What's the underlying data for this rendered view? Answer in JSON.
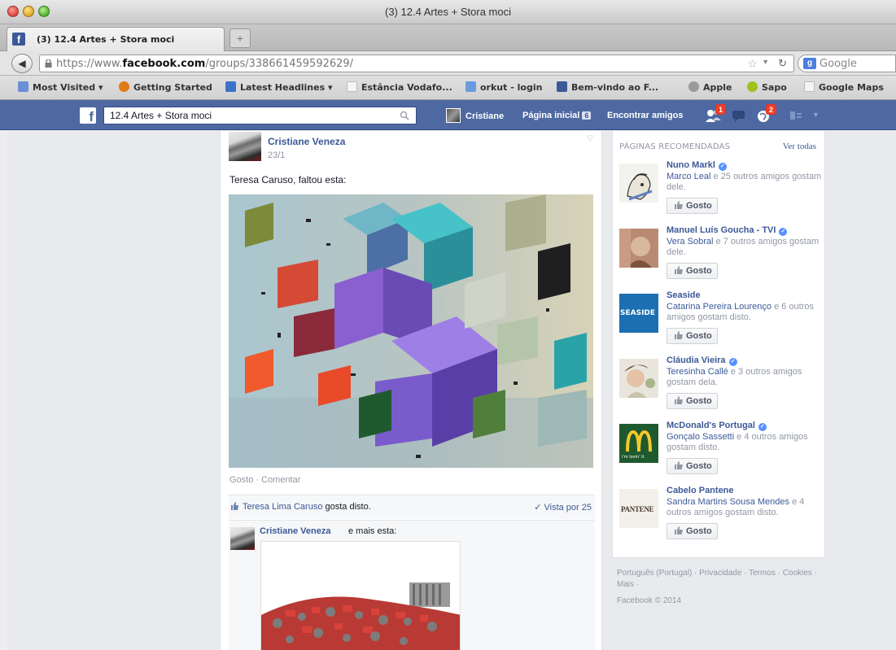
{
  "window": {
    "title": "(3) 12.4 Artes + Stora moci",
    "tab_label": "(3) 12.4 Artes + Stora moci",
    "new_tab_icon": "plus-icon"
  },
  "navbar": {
    "url_prefix": "https://www.",
    "url_domain": "facebook.com",
    "url_path": "/groups/338661459592629/",
    "search_engine": "Google"
  },
  "bookmarks": [
    {
      "label": "Most Visited ▾",
      "icon": "most-visited-icon",
      "color": "#6a8fd6"
    },
    {
      "label": "Getting Started",
      "icon": "firefox-icon",
      "color": "#e07a18"
    },
    {
      "label": "Latest Headlines ▾",
      "icon": "rss-icon",
      "color": "#3a72c9"
    },
    {
      "label": "Estância Vodafo...",
      "icon": "page-icon",
      "color": "#f4f4f4"
    },
    {
      "label": "orkut - login",
      "icon": "orkut-icon",
      "color": "#6a9bde"
    },
    {
      "label": "Bem-vindo ao F...",
      "icon": "facebook-icon",
      "color": "#3b5998"
    },
    {
      "label": "Apple",
      "icon": "apple-icon",
      "color": "#9a9a9a"
    },
    {
      "label": "Sapo",
      "icon": "sapo-icon",
      "color": "#9fc21c"
    },
    {
      "label": "Google Maps",
      "icon": "page-icon",
      "color": "#f4f4f4"
    }
  ],
  "fb_header": {
    "search_value": "12.4 Artes + Stora moci",
    "user_name": "Cristiane",
    "home_label": "Página inicial",
    "home_count": "6",
    "find_friends": "Encontrar amigos",
    "friend_requests_badge": "1",
    "notifications_badge": "2",
    "brand_color": "#4e69a2"
  },
  "post": {
    "author": "Cristiane Veneza",
    "time": "23/1",
    "text": "Teresa Caruso, faltou esta:",
    "actions": "Gosto · Comentar",
    "liked_by": "Teresa Lima Caruso",
    "liked_suffix": " gosta disto.",
    "seen_by": "✓ Vista por 25"
  },
  "comment": {
    "author": "Cristiane Veneza",
    "text": "e mais esta:"
  },
  "recommended": {
    "title": "PÁGINAS RECOMENDADAS",
    "see_all": "Ver todas",
    "items": [
      {
        "name": "Nuno Markl",
        "friends": "Marco Leal",
        "rest": " e 25 outros amigos gostam dele.",
        "button": "Gosto"
      },
      {
        "name": "Manuel Luís Goucha - TVI",
        "friends": "Vera Sobral",
        "rest": " e 7 outros amigos gostam dele.",
        "button": "Gosto"
      },
      {
        "name": "Seaside",
        "friends": "Catarina Pereira Lourenço",
        "rest": " e 6 outros amigos gostam disto.",
        "button": "Gosto"
      },
      {
        "name": "Cláudia Vieira",
        "friends": "Teresinha Callé",
        "rest": " e 3 outros amigos gostam dela.",
        "button": "Gosto"
      },
      {
        "name": "McDonald's Portugal",
        "friends": "Gonçalo Sassetti",
        "rest": " e 4 outros amigos gostam disto.",
        "button": "Gosto"
      },
      {
        "name": "Cabelo Pantene",
        "friends": "Sandra Martins Sousa Mendes",
        "rest": " e 4 outros amigos gostam disto.",
        "button": "Gosto"
      }
    ],
    "thumb_texts": {
      "seaside": "SEASIDE",
      "mcdonalds_sub": "i'm lovin' it",
      "pantene": "PANTENE"
    }
  },
  "footer": {
    "links": "Português (Portugal) · Privacidade · Termos · Cookies · Mais ·",
    "copyright": "Facebook © 2014"
  }
}
